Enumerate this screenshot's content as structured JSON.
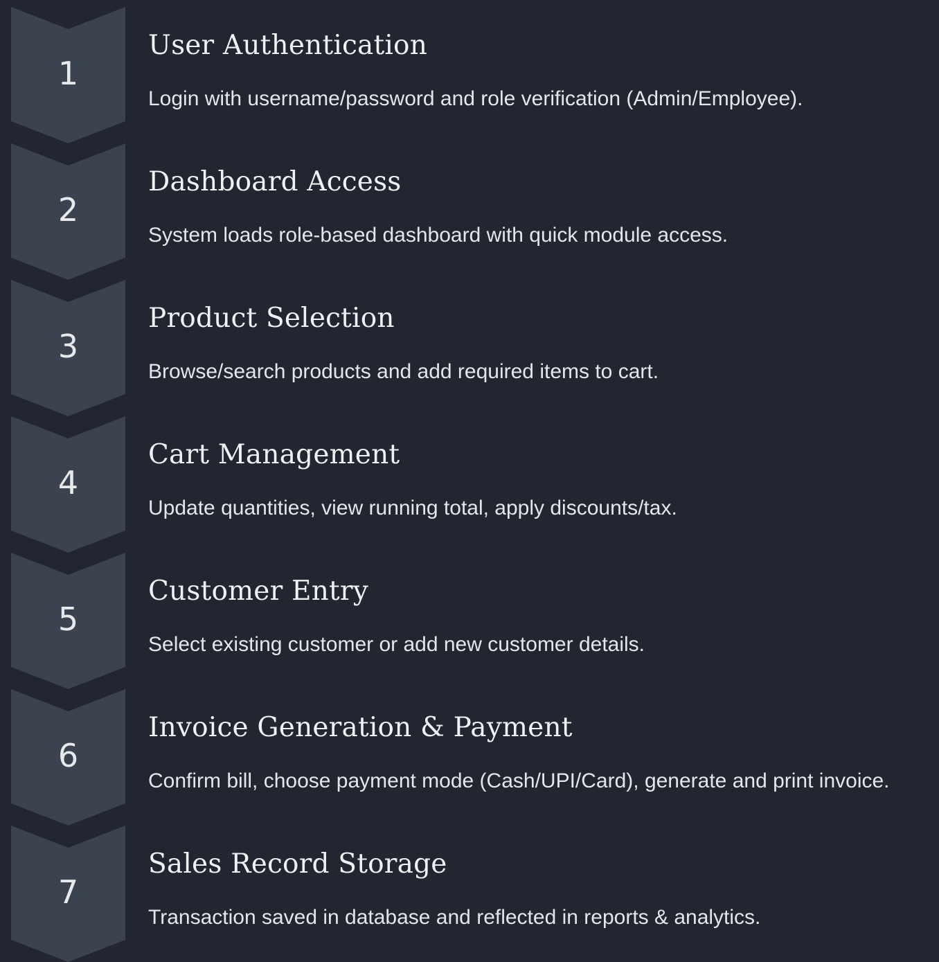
{
  "colors": {
    "background": "#212631",
    "chevron": "#3b4250",
    "text": "#f0f1f3"
  },
  "steps": [
    {
      "number": "1",
      "title": "User Authentication",
      "description": "Login with username/password and role verification (Admin/Employee)."
    },
    {
      "number": "2",
      "title": "Dashboard Access",
      "description": "System loads role-based dashboard with quick module access."
    },
    {
      "number": "3",
      "title": "Product Selection",
      "description": "Browse/search products and add required items to cart."
    },
    {
      "number": "4",
      "title": "Cart Management",
      "description": "Update quantities, view running total, apply discounts/tax."
    },
    {
      "number": "5",
      "title": "Customer Entry",
      "description": "Select existing customer or add new customer details."
    },
    {
      "number": "6",
      "title": "Invoice Generation & Payment",
      "description": "Confirm bill, choose payment mode (Cash/UPI/Card), generate and print invoice."
    },
    {
      "number": "7",
      "title": "Sales Record Storage",
      "description": "Transaction saved in database and reflected in reports & analytics."
    }
  ]
}
